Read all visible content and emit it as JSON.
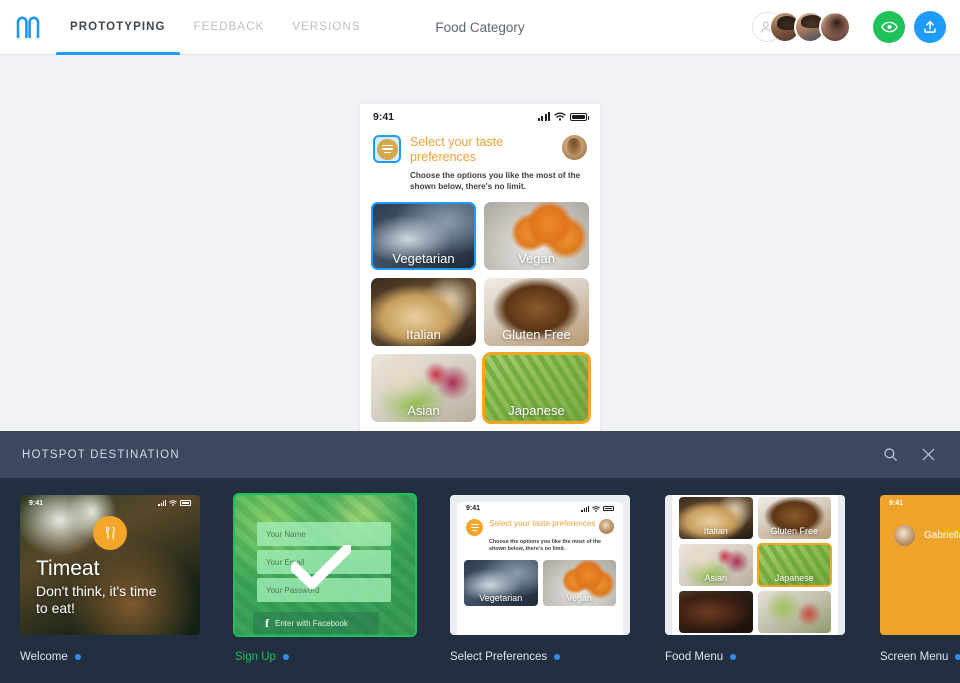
{
  "header": {
    "logo_name": "marvel-logo",
    "title": "Food Category",
    "tabs": [
      {
        "label": "PROTOTYPING",
        "active": true
      },
      {
        "label": "FEEDBACK",
        "active": false
      },
      {
        "label": "VERSIONS",
        "active": false
      }
    ],
    "add_collaborator_icon": "add-user-icon",
    "preview_icon": "eye-icon",
    "share_icon": "upload-icon",
    "accent_blue": "#1f9cfb",
    "accent_green": "#1ec15a"
  },
  "phone": {
    "status_time": "9:41",
    "screen_title": "Select your taste preferences",
    "screen_sub": "Choose the options you like the most of the shown below, there's no limit.",
    "menu_icon": "hamburger-icon",
    "avatar_name": "user-avatar",
    "tiles": [
      {
        "label": "Vegetarian",
        "img": "im-veg",
        "hotspot": "blue"
      },
      {
        "label": "Vegan",
        "img": "im-vgn",
        "hotspot": "none"
      },
      {
        "label": "Italian",
        "img": "im-ita",
        "hotspot": "none"
      },
      {
        "label": "Gluten Free",
        "img": "im-glu",
        "hotspot": "none"
      },
      {
        "label": "Asian",
        "img": "im-asi",
        "hotspot": "none"
      },
      {
        "label": "Japanese",
        "img": "im-jap",
        "hotspot": "orange"
      }
    ]
  },
  "panel": {
    "title": "HOTSPOT DESTINATION",
    "search_icon": "search-icon",
    "close_icon": "close-icon",
    "bg": "#222f40",
    "head_bg": "#3b4860",
    "screens": [
      {
        "label": "Welcome",
        "selected": false,
        "status_time": "9:41",
        "brand": "Timeat",
        "tagline": "Don't think, it's time to eat!",
        "icon": "fork-knife-icon"
      },
      {
        "label": "Sign Up",
        "selected": true,
        "fields": [
          "Your Name",
          "Your Email",
          "Your Password"
        ],
        "facebook_label": "Enter with Facebook",
        "check_icon": "checkmark-icon"
      },
      {
        "label": "Select Preferences",
        "selected": false,
        "status_time": "9:41",
        "screen_title": "Select your taste preferences",
        "screen_sub": "Choose the options you like the most of the shown below, there's no limit.",
        "tiles": [
          {
            "label": "Vegetarian",
            "img": "im-veg"
          },
          {
            "label": "Vegan",
            "img": "im-vgn"
          }
        ]
      },
      {
        "label": "Food Menu",
        "selected": false,
        "tiles": [
          {
            "label": "Italian",
            "img": "im-ita",
            "hotspot": "none"
          },
          {
            "label": "Gluten Free",
            "img": "im-glu",
            "hotspot": "none"
          },
          {
            "label": "Asian",
            "img": "im-asi",
            "hotspot": "none"
          },
          {
            "label": "Japanese",
            "img": "im-jap",
            "hotspot": "orange"
          },
          {
            "label": "",
            "img": "im-stk",
            "hotspot": "none"
          },
          {
            "label": "",
            "img": "im-sld",
            "hotspot": "none"
          }
        ]
      },
      {
        "label": "Screen Menu",
        "selected": false,
        "status_time": "9:41",
        "user_name": "Gabriella"
      }
    ]
  }
}
